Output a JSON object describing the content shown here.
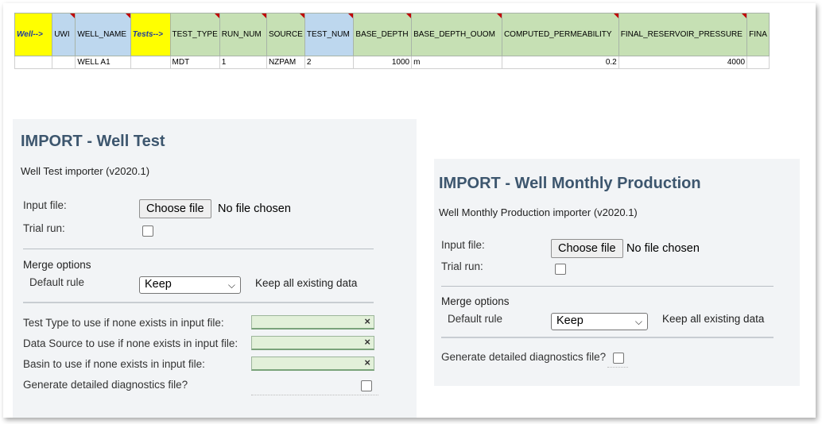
{
  "spreadsheet": {
    "columns": [
      {
        "label": "Well-->",
        "style": "yellow"
      },
      {
        "label": "UWI",
        "style": "blue"
      },
      {
        "label": "WELL_NAME",
        "style": "blue"
      },
      {
        "label": "Tests-->",
        "style": "yellow"
      },
      {
        "label": "TEST_TYPE",
        "style": "green"
      },
      {
        "label": "RUN_NUM",
        "style": "green"
      },
      {
        "label": "SOURCE",
        "style": "green"
      },
      {
        "label": "TEST_NUM",
        "style": "blue"
      },
      {
        "label": "BASE_DEPTH",
        "style": "green"
      },
      {
        "label": "BASE_DEPTH_OUOM",
        "style": "green"
      },
      {
        "label": "COMPUTED_PERMEABILITY",
        "style": "green"
      },
      {
        "label": "FINAL_RESERVOIR_PRESSURE",
        "style": "green"
      },
      {
        "label": "FINA",
        "style": "green"
      }
    ],
    "rows": [
      [
        "",
        "",
        "WELL A1",
        "",
        "MDT",
        "1",
        "NZPAM",
        "2",
        "1000",
        "m",
        "0.2",
        "4000",
        ""
      ]
    ]
  },
  "well_test": {
    "title": "IMPORT - Well Test",
    "subtitle": "Well Test importer (v2020.1)",
    "input_file_label": "Input file:",
    "choose_file_label": "Choose file",
    "no_file_text": "No file chosen",
    "trial_run_label": "Trial run:",
    "merge_options_label": "Merge options",
    "default_rule_label": "Default rule",
    "default_rule_value": "Keep",
    "default_rule_desc": "Keep all existing data",
    "test_type_label": "Test Type to use if none exists in input file:",
    "data_source_label": "Data Source to use if none exists in input file:",
    "basin_label": "Basin to use if none exists in input file:",
    "clear_symbol": "×",
    "diagnostics_label": "Generate detailed diagnostics file?"
  },
  "monthly_production": {
    "title": "IMPORT - Well Monthly Production",
    "subtitle": "Well Monthly Production importer (v2020.1)",
    "input_file_label": "Input file:",
    "choose_file_label": "Choose file",
    "no_file_text": "No file chosen",
    "trial_run_label": "Trial run:",
    "merge_options_label": "Merge options",
    "default_rule_label": "Default rule",
    "default_rule_value": "Keep",
    "default_rule_desc": "Keep all existing data",
    "diagnostics_label": "Generate detailed diagnostics file?"
  },
  "colors": {
    "title": "#3d566e",
    "panel_bg": "#f2f4f6",
    "header_yellow": "#ffff00",
    "header_blue": "#bdd7ee",
    "header_green": "#c6e0b4"
  }
}
